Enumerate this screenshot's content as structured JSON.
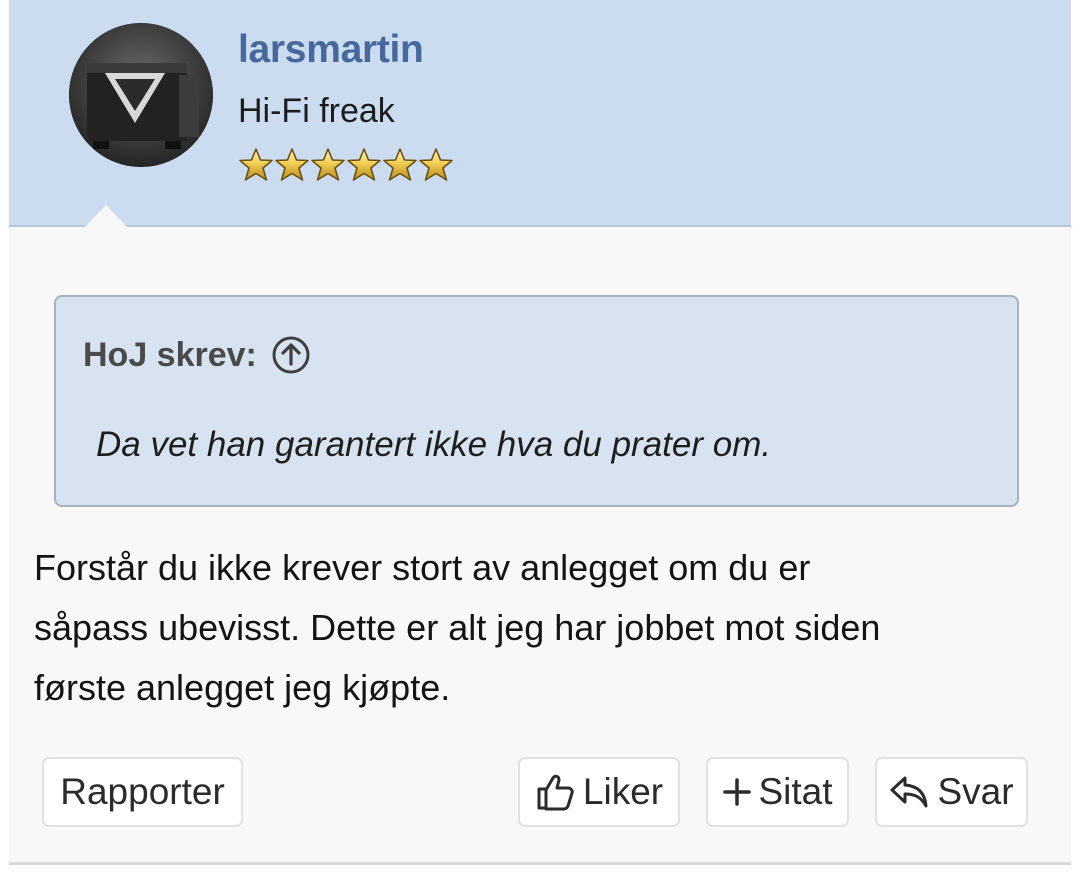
{
  "user": {
    "name": "larsmartin",
    "title": "Hi-Fi freak",
    "rating_stars": 6,
    "avatar": "user-avatar-photo"
  },
  "quote": {
    "author_label": "HoJ skrev:",
    "jump_icon": "arrow-up-circle-icon",
    "text": "Da vet han garantert ikke hva du prater om."
  },
  "message": {
    "lines": [
      "Forstår du ikke krever stort av anlegget om du er",
      "såpass ubevisst. Dette er alt jeg har jobbet mot siden",
      "første anlegget jeg kjøpte."
    ]
  },
  "actions": {
    "report": "Rapporter",
    "like": "Liker",
    "quote": "Sitat",
    "reply": "Svar"
  },
  "colors": {
    "header_bg": "#cbdcf1",
    "username": "#47689a",
    "quote_bg": "#d8e3f1"
  }
}
